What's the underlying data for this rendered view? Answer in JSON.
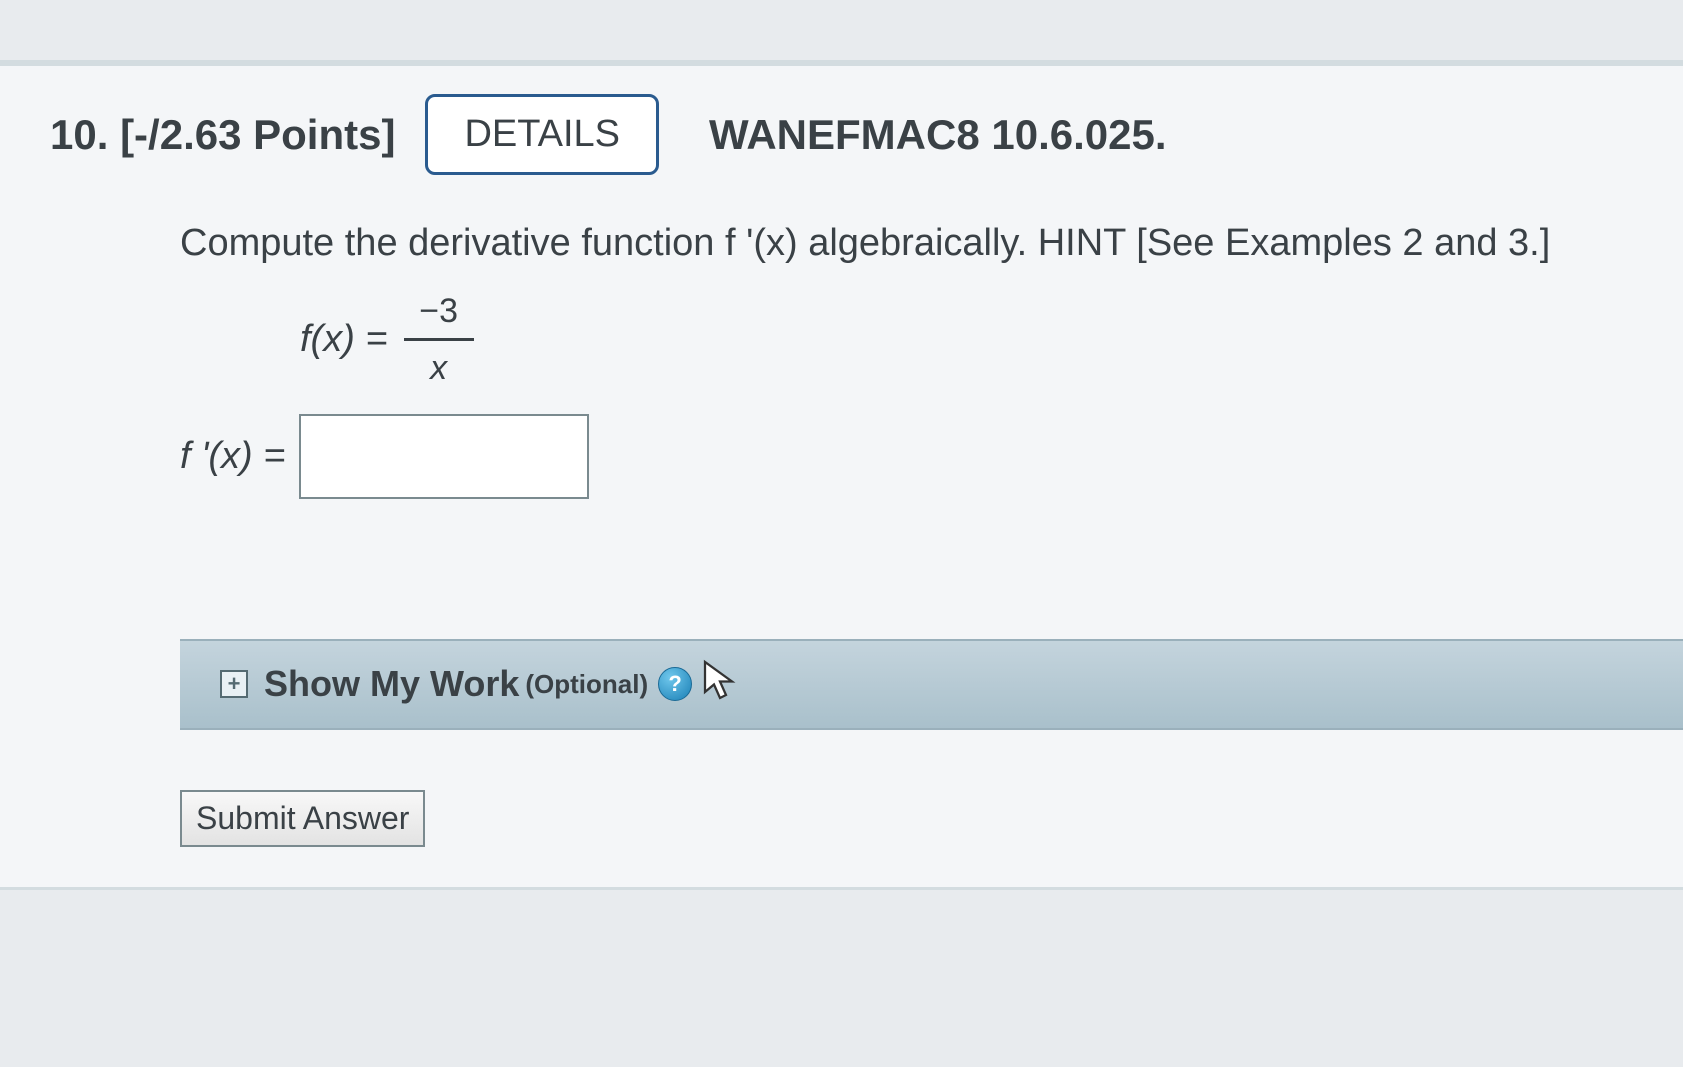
{
  "header": {
    "number": "10.",
    "points": "[-/2.63 Points]",
    "details_label": "DETAILS",
    "reference": "WANEFMAC8 10.6.025."
  },
  "prompt": {
    "text": "Compute the derivative function f '(x) algebraically. ",
    "hint": "HINT [See Examples 2 and 3.]"
  },
  "function": {
    "label": "f(x) =",
    "numerator": "−3",
    "denominator": "x"
  },
  "answer": {
    "label": "f '(x) =",
    "value": ""
  },
  "show_work": {
    "label": "Show My Work",
    "optional": "(Optional)"
  },
  "submit": {
    "label": "Submit Answer"
  }
}
